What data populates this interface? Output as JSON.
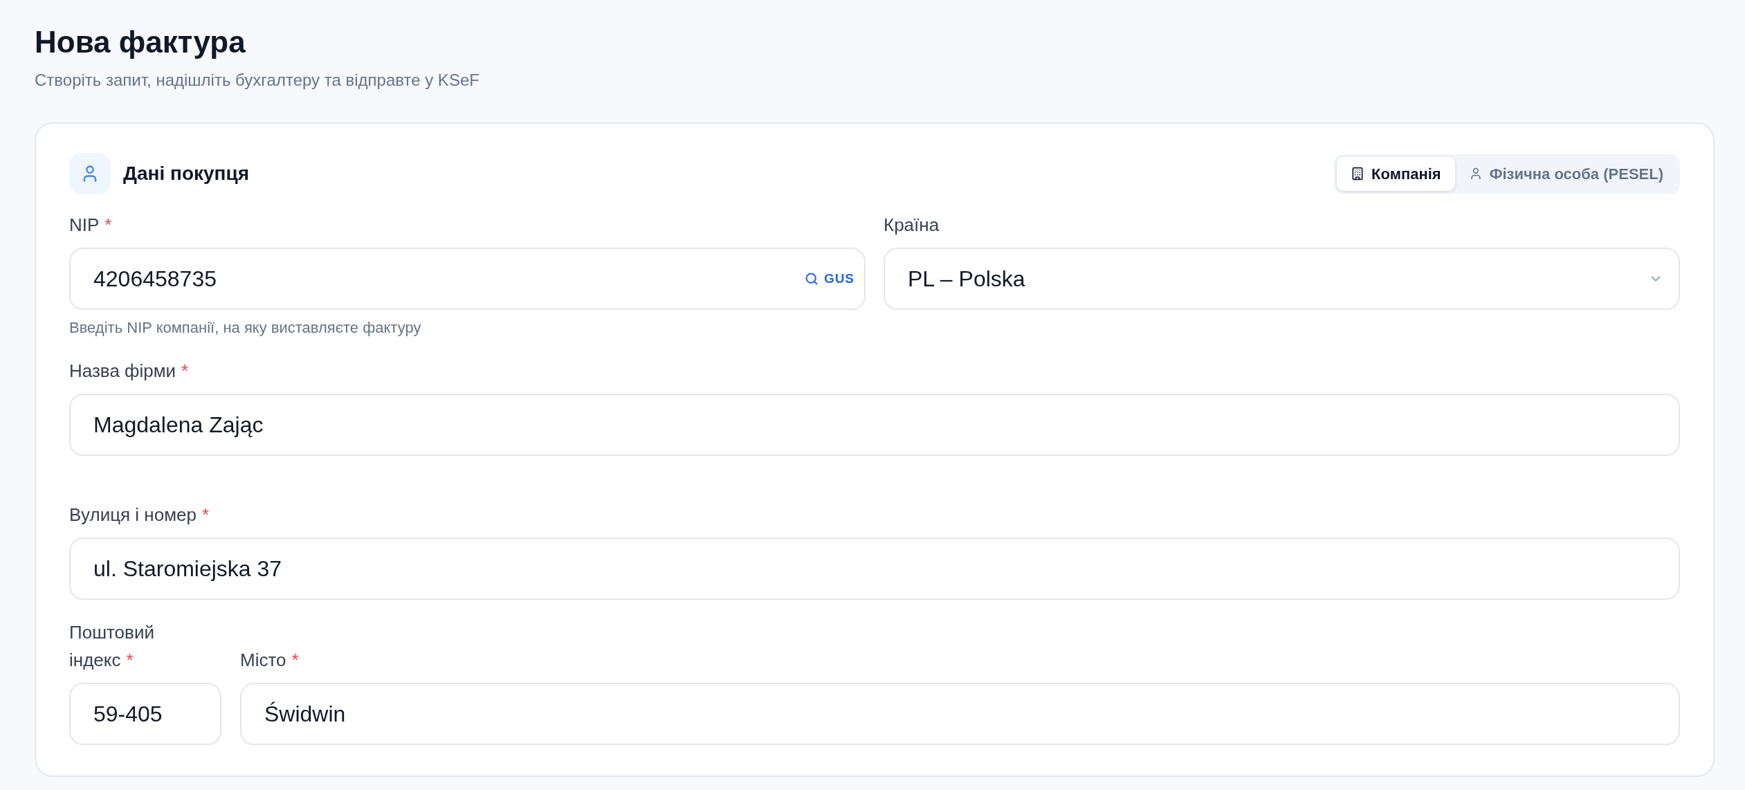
{
  "header": {
    "title": "Нова фактура",
    "subtitle": "Створіть запит, надішліть бухгалтеру та відправте у KSeF"
  },
  "buyer_section": {
    "title": "Дані покупця",
    "buyer_type_tabs": [
      {
        "kind": "company",
        "label": "Компанія",
        "selected": true
      },
      {
        "kind": "person",
        "label": "Фізична особа (PESEL)",
        "selected": false
      }
    ],
    "rows": [
      {
        "fields": [
          {
            "kind": "lookup",
            "label": "NIP",
            "required_mark": "*",
            "value": "4206458735",
            "action": "GUS",
            "hint": "Введіть NIP компанії, на яку виставляєте фактуру"
          },
          {
            "kind": "select",
            "label": "Країна",
            "value": "PL – Polska"
          }
        ]
      },
      {
        "fields": [
          {
            "kind": "text",
            "label": "Назва фірми",
            "required_mark": "*",
            "value": "Magdalena Zając"
          }
        ]
      },
      {
        "fields": [
          {
            "kind": "text",
            "label": "Вулиця і номер",
            "required_mark": "*",
            "value": "ul. Staromiejska 37"
          }
        ]
      },
      {
        "fields": [
          {
            "kind": "text",
            "label": "Поштовий індекс",
            "required_mark": "*",
            "value": "59-405"
          },
          {
            "kind": "text",
            "label": "Місто",
            "required_mark": "*",
            "value": "Świdwin"
          }
        ]
      }
    ]
  }
}
